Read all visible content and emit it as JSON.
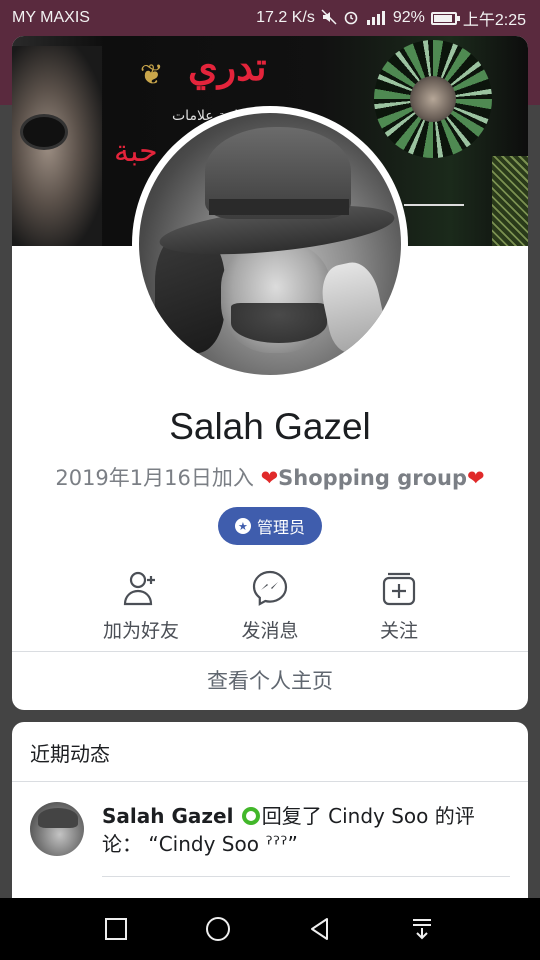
{
  "status_bar": {
    "carrier": "MY MAXIS",
    "speed": "17.2 K/s",
    "battery": "92%",
    "time": "上午2:25"
  },
  "profile": {
    "name": "Salah Gazel",
    "joined": "2019年1月16日加入",
    "group": "Shopping group",
    "badge": "管理员"
  },
  "actions": {
    "add_friend": "加为好友",
    "message": "发消息",
    "follow": "关注"
  },
  "view_profile": "查看个人主页",
  "recent_activity": {
    "title": "近期动态",
    "item": {
      "author": "Salah Gazel",
      "text": "回复了 Cindy Soo 的评论： “Cindy Soo ˀˀˀ”"
    }
  },
  "colors": {
    "accent": "#3f5dad",
    "heart": "#e02a2a",
    "moderator_green": "#42b72a"
  }
}
